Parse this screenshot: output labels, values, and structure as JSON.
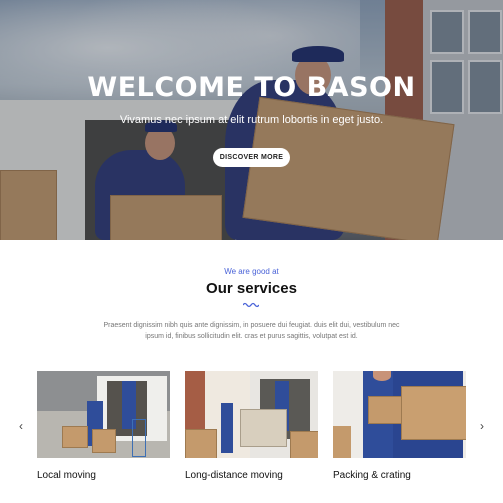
{
  "hero": {
    "title": "WELCOME TO BASON",
    "subtitle": "Vivamus nec ipsum at elit rutrum lobortis in eget justo.",
    "button_label": "DISCOVER MORE"
  },
  "services": {
    "eyebrow": "We are good at",
    "title": "Our services",
    "description": "Praesent dignissim nibh quis ante dignissim, in posuere dui feugiat. duis elit dui, vestibulum nec ipsum id, finibus sollicitudin elit. cras et purus sagittis, volutpat est id.",
    "prev_icon": "chevron-left-icon",
    "next_icon": "chevron-right-icon",
    "cards": [
      {
        "label": "Local moving"
      },
      {
        "label": "Long-distance moving"
      },
      {
        "label": "Packing & crating"
      }
    ]
  },
  "colors": {
    "accent": "#4a63d8"
  }
}
